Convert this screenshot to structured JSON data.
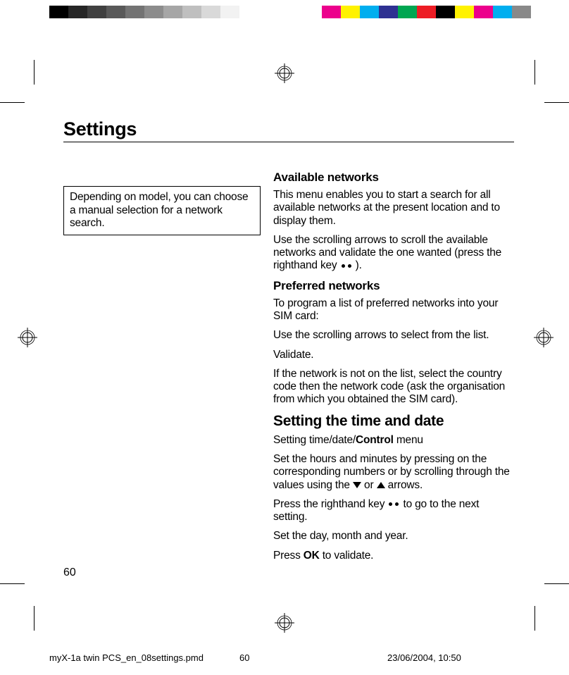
{
  "colorbars": {
    "left": [
      "#000000",
      "#262626",
      "#404040",
      "#595959",
      "#737373",
      "#8c8c8c",
      "#a6a6a6",
      "#bfbfbf",
      "#d9d9d9",
      "#f2f2f2",
      "#ffffff"
    ],
    "right": [
      "#ffffff",
      "#ec008c",
      "#fff200",
      "#00aeef",
      "#2e3192",
      "#00a651",
      "#ed1c24",
      "#000000",
      "#fff200",
      "#ec008c",
      "#00aeef",
      "#898989"
    ]
  },
  "title": "Settings",
  "sidebar_note": "Depending on model, you can choose a manual selection for a network search.",
  "sections": {
    "available": {
      "heading": "Available networks",
      "p1": "This menu enables you to start a search for all available networks at the present location and to display them.",
      "p2a": "Use the scrolling arrows to scroll the available networks and validate the one wanted (press the righthand key ",
      "p2b": " )."
    },
    "preferred": {
      "heading": "Preferred networks",
      "p1": "To program a list of preferred networks into your SIM card:",
      "p2": "Use the scrolling arrows to select from the list.",
      "p3": "Validate.",
      "p4": "If the network is not on the list, select the country code then the network code (ask the organisation from which you obtained the SIM card)."
    },
    "timedate": {
      "heading": "Setting the time and date",
      "p1a": "Setting time/date/",
      "p1b": "Control",
      "p1c": " menu",
      "p2a": "Set the hours and minutes by pressing on the corresponding numbers or by scrolling through the values using the ",
      "p2b": " or ",
      "p2c": " arrows.",
      "p3a": "Press the righthand key ",
      "p3b": " to go to the next setting.",
      "p4": "Set the day, month and year.",
      "p5a": "Press ",
      "p5b": "OK",
      "p5c": " to validate."
    }
  },
  "page_number": "60",
  "footer": {
    "filename": "myX-1a twin PCS_en_08settings.pmd",
    "page": "60",
    "date": "23/06/2004, 10:50"
  }
}
